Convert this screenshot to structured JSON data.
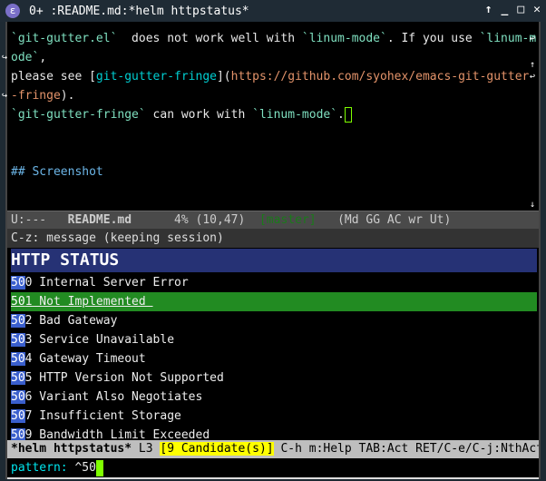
{
  "window": {
    "title": "0+  :README.md:*helm httpstatus*",
    "buttons": [
      "↑",
      "_",
      "□",
      "✕"
    ]
  },
  "editor": {
    "lines": [
      {
        "parts": [
          [
            "code",
            "`git-gutter.el`"
          ],
          [
            "",
            "  does not work well with "
          ],
          [
            "code",
            "`linum-mode`"
          ],
          [
            "",
            ". If you use "
          ],
          [
            "code",
            "`linum-m"
          ]
        ]
      },
      {
        "parts": [
          [
            "code",
            "ode`"
          ],
          [
            "",
            ","
          ]
        ]
      },
      {
        "parts": [
          [
            "",
            "please see ["
          ],
          [
            "link",
            "git-gutter-fringe"
          ],
          [
            "",
            "]("
          ],
          [
            "url",
            "https://github.com/syohex/emacs-git-gutter"
          ]
        ]
      },
      {
        "parts": [
          [
            "url",
            "-fringe"
          ],
          [
            "",
            ")."
          ]
        ]
      },
      {
        "parts": [
          [
            "code",
            "`git-gutter-fringe`"
          ],
          [
            "",
            " can work with "
          ],
          [
            "code",
            "`linum-mode`"
          ],
          [
            "",
            "."
          ]
        ]
      },
      {
        "parts": [
          [
            "hd",
            "## Screenshot"
          ]
        ]
      }
    ]
  },
  "modeline": {
    "status": "U:---",
    "buffer": "README.md",
    "position": "4% (10,47)",
    "branch": "[master]",
    "modes": "(Md GG AC wr Ut)"
  },
  "message": "C-z: message (keeping session)",
  "helm": {
    "header": "HTTP STATUS",
    "items": [
      {
        "match": "50",
        "rest": "0 Internal Server Error"
      },
      {
        "match": "50",
        "rest": "1 Not Implemented "
      },
      {
        "match": "50",
        "rest": "2 Bad Gateway"
      },
      {
        "match": "50",
        "rest": "3 Service Unavailable"
      },
      {
        "match": "50",
        "rest": "4 Gateway Timeout"
      },
      {
        "match": "50",
        "rest": "5 HTTP Version Not Supported"
      },
      {
        "match": "50",
        "rest": "6 Variant Also Negotiates"
      },
      {
        "match": "50",
        "rest": "7 Insufficient Storage"
      },
      {
        "match": "50",
        "rest": "9 Bandwidth Limit Exceeded"
      }
    ],
    "selected_index": 1,
    "modeline": {
      "buffer": "*helm httpstatus*",
      "line": "L3",
      "candidates": "[9 Candidate(s)]",
      "help": "C-h m:Help TAB:Act RET/C-e/C-j:NthAct"
    },
    "prompt": "pattern: ",
    "pattern": "^50"
  },
  "colors": {
    "header_bg": "#263275",
    "selected_bg": "#228b22",
    "match_bg": "#3a5fcd",
    "candidates_bg": "#ffff00",
    "cursor": "#7fff00"
  }
}
